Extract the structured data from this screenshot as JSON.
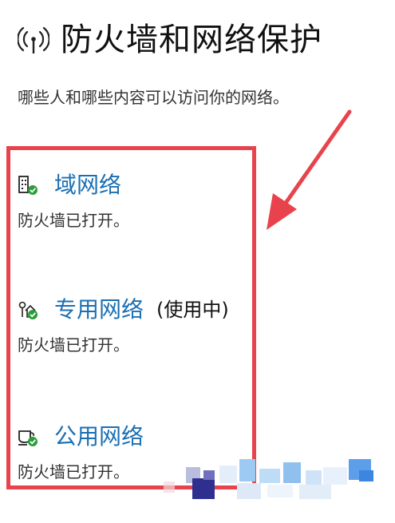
{
  "header": {
    "icon": "wifi-signal-icon",
    "title": "防火墙和网络保护"
  },
  "subtitle": "哪些人和哪些内容可以访问你的网络。",
  "networks": [
    {
      "icon": "domain-building-icon",
      "name": "域网络",
      "in_use": "",
      "status": "防火墙已打开。"
    },
    {
      "icon": "private-home-icon",
      "name": "专用网络",
      "in_use": "(使用中)",
      "status": "防火墙已打开。"
    },
    {
      "icon": "public-cafe-icon",
      "name": "公用网络",
      "in_use": "",
      "status": "防火墙已打开。"
    }
  ],
  "colors": {
    "link": "#1a6fb3",
    "highlight": "#e8434c",
    "check": "#2a9d3a"
  }
}
